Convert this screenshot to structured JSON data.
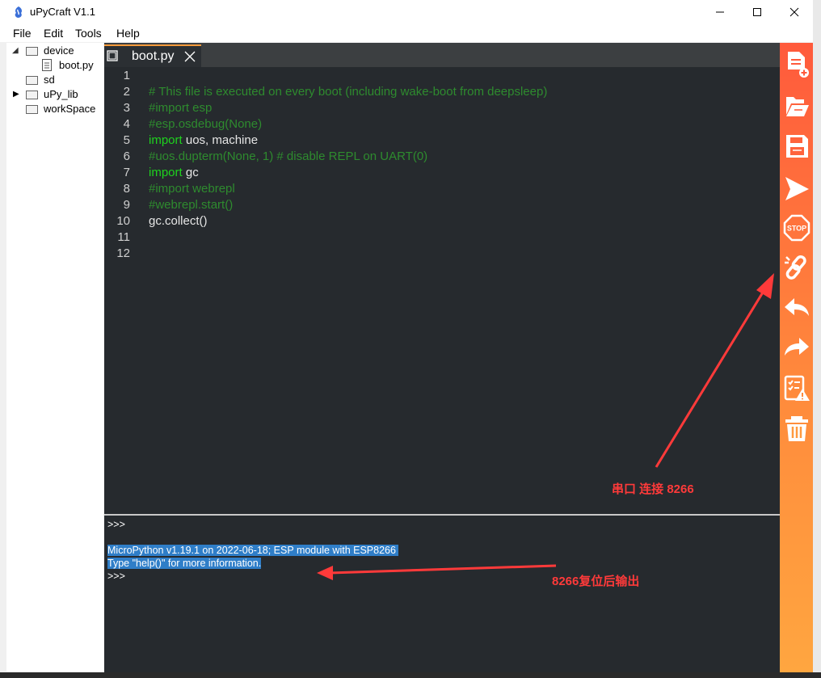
{
  "window": {
    "title": "uPyCraft V1.1"
  },
  "menu": [
    "File",
    "Edit",
    "Tools",
    "Help"
  ],
  "tree": {
    "device": "device",
    "boot": "boot.py",
    "sd": "sd",
    "lib": "uPy_lib",
    "workspace": "workSpace"
  },
  "tab": {
    "label": "boot.py"
  },
  "editor": {
    "line_numbers": [
      "1",
      "2",
      "3",
      "4",
      "5",
      "6",
      "7",
      "8",
      "9",
      "10",
      "11",
      "12"
    ],
    "l2": "# This file is executed on every boot (including wake-boot from deepsleep)",
    "l3": "#import esp",
    "l4": "#esp.osdebug(None)",
    "l5_kw": "import",
    "l5_txt": " uos, machine",
    "l6": "#uos.dupterm(None, 1) # disable REPL on UART(0)",
    "l7_kw": "import",
    "l7_txt": " gc",
    "l8": "#import webrepl",
    "l9": "#webrepl.start()",
    "l10": "gc.collect()"
  },
  "terminal": {
    "prompt1": ">>>",
    "line1": "MicroPython v1.19.1 on 2022-06-18; ESP module with ESP8266 ",
    "line2": "Type \"help()\" for more information.",
    "prompt2": ">>>"
  },
  "toolbar_icons": [
    "new-file-icon",
    "open-file-icon",
    "save-icon",
    "run-icon",
    "stop-icon",
    "connect-icon",
    "undo-icon",
    "redo-icon",
    "check-syntax-icon",
    "clear-icon"
  ],
  "annotations": {
    "connect": "串口 连接 8266",
    "output": "8266复位后输出"
  },
  "colors": {
    "toolbar_top": "#ff5a3c",
    "toolbar_bottom": "#ffa640",
    "annotation": "#ff3a3a",
    "tab_accent": "#f59a3a"
  }
}
